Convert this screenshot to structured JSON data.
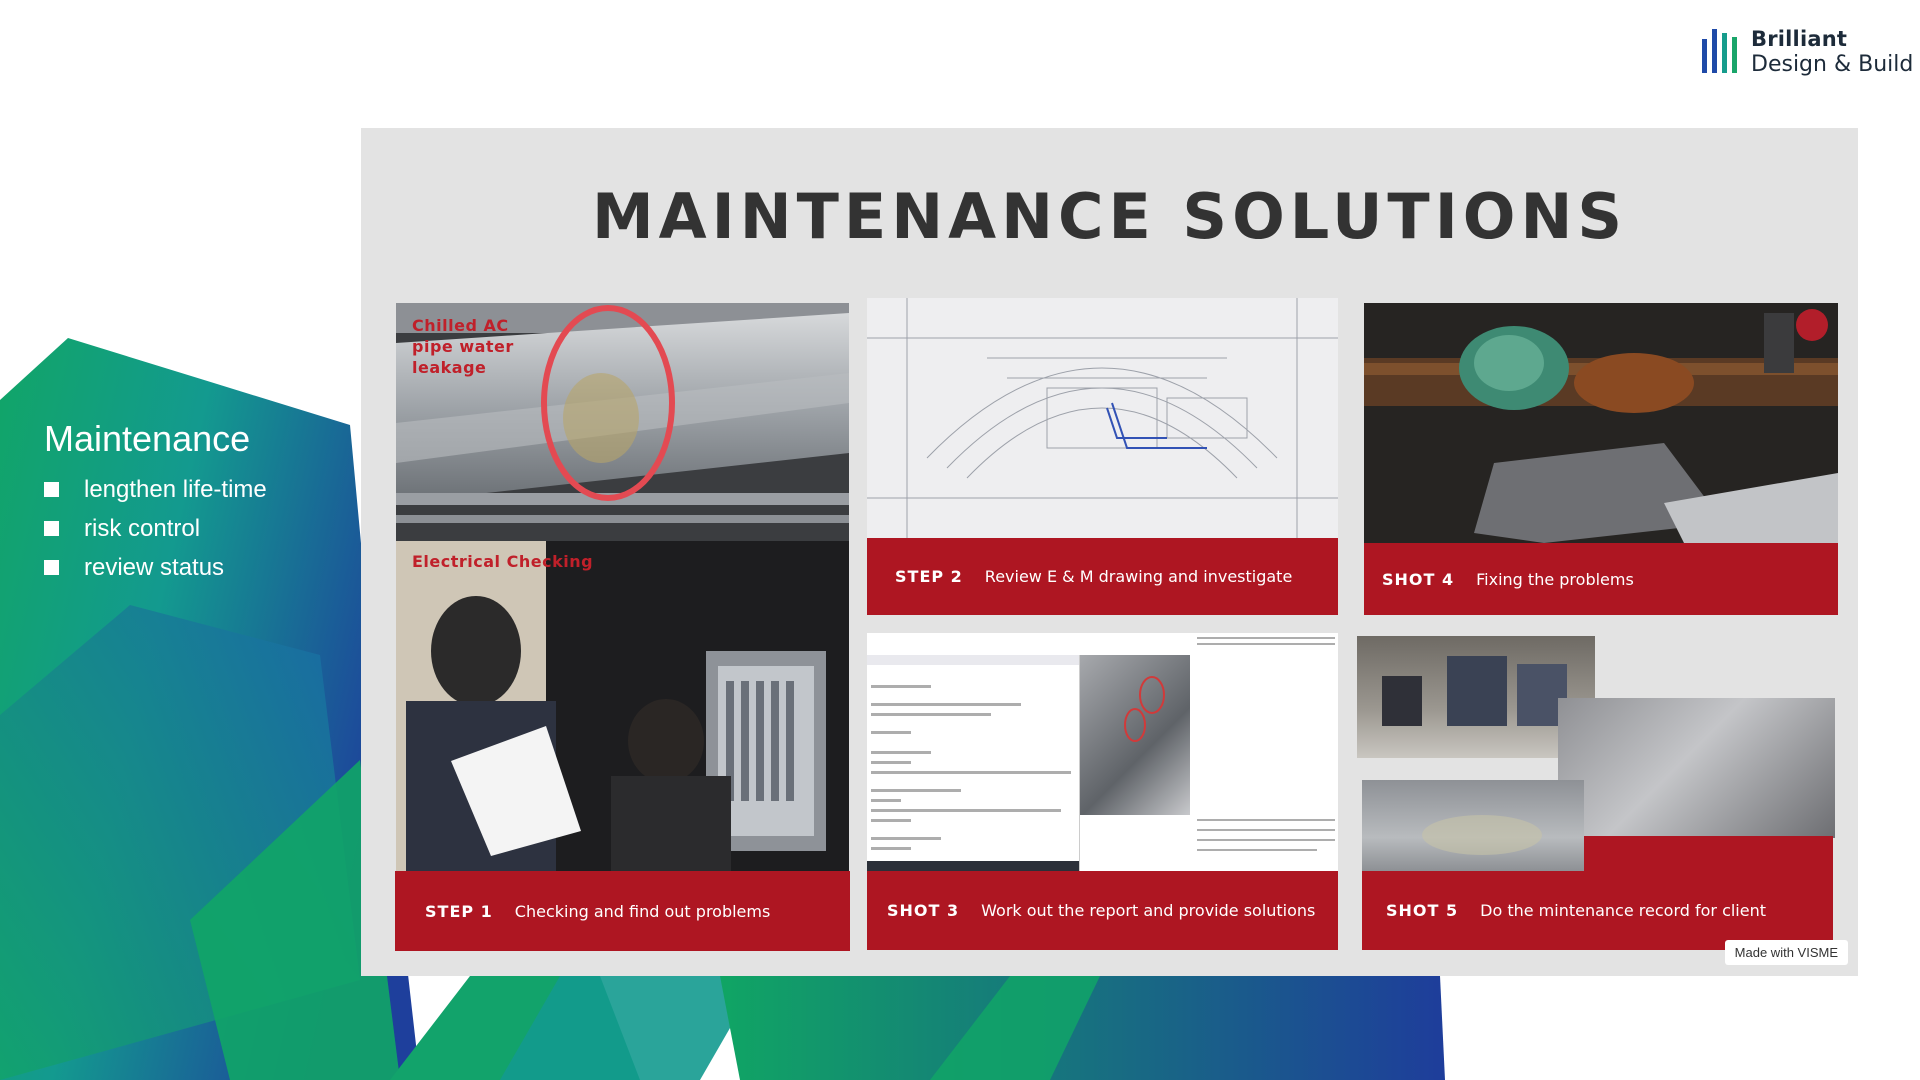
{
  "brand": {
    "name_line1": "Brilliant",
    "name_line2": "Design & Build",
    "bar_colors": [
      "#1f4aa8",
      "#1f4aa8",
      "#169c8c",
      "#1aa56a"
    ]
  },
  "sidebar": {
    "title": "Maintenance",
    "items": [
      "lengthen life-time",
      "risk control",
      "review status"
    ]
  },
  "slide": {
    "title": "MAINTENANCE SOLUTIONS",
    "photo_labels": {
      "pipe_leak": "Chilled AC pipe water leakage",
      "electrical": "Electrical Checking"
    },
    "steps": [
      {
        "tag": "STEP 1",
        "text": "Checking and find out problems"
      },
      {
        "tag": "STEP 2",
        "text": "Review E & M drawing and investigate"
      },
      {
        "tag": "SHOT 3",
        "text": "Work out the report and provide solutions"
      },
      {
        "tag": "SHOT 4",
        "text": "Fixing the problems"
      },
      {
        "tag": "SHOT 5",
        "text": "Do the mintenance record for client"
      }
    ],
    "watermark": "Made with VISME"
  },
  "colors": {
    "accent_red": "#ae1622",
    "slide_bg": "#e3e3e3",
    "bg_blue": "#1e3f9c",
    "bg_teal": "#139a8f",
    "bg_green": "#11a567"
  }
}
